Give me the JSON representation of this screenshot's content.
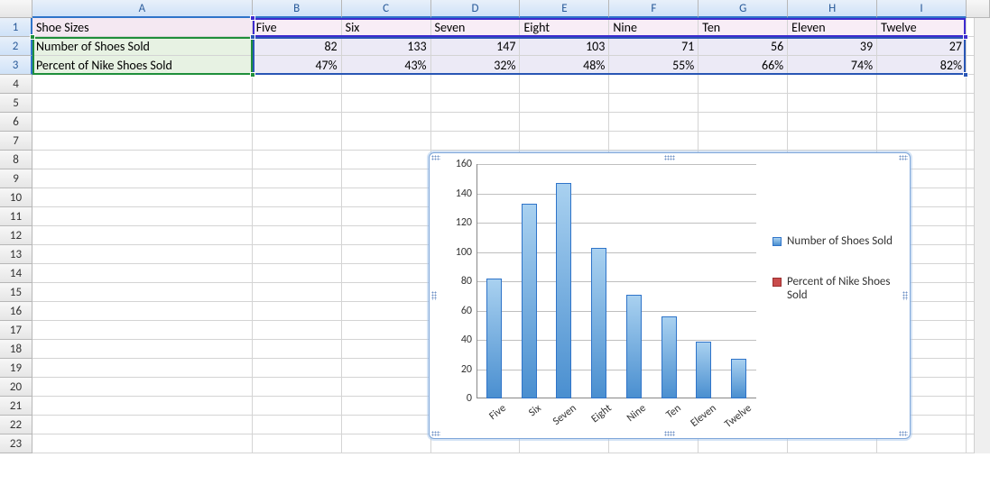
{
  "columns": [
    "A",
    "B",
    "C",
    "D",
    "E",
    "F",
    "G",
    "H",
    "I"
  ],
  "rowNumbers": [
    1,
    2,
    3,
    4,
    5,
    6,
    7,
    8,
    9,
    10,
    11,
    12,
    13,
    14,
    15,
    16,
    17,
    18,
    19,
    20,
    21,
    22,
    23
  ],
  "table": {
    "labels": {
      "sizes": "Shoe Sizes",
      "count": "Number of Shoes Sold",
      "pct": "Percent of Nike Shoes Sold"
    },
    "sizeNames": [
      "Five",
      "Six",
      "Seven",
      "Eight",
      "Nine",
      "Ten",
      "Eleven",
      "Twelve"
    ],
    "counts": [
      "82",
      "133",
      "147",
      "103",
      "71",
      "56",
      "39",
      "27"
    ],
    "percents": [
      "47%",
      "43%",
      "32%",
      "48%",
      "55%",
      "66%",
      "74%",
      "82%"
    ]
  },
  "chart_data": {
    "type": "bar",
    "categories": [
      "Five",
      "Six",
      "Seven",
      "Eight",
      "Nine",
      "Ten",
      "Eleven",
      "Twelve"
    ],
    "series": [
      {
        "name": "Number of Shoes Sold",
        "values": [
          82,
          133,
          147,
          103,
          71,
          56,
          39,
          27
        ]
      },
      {
        "name": "Percent of Nike Shoes Sold",
        "values": [
          0.47,
          0.43,
          0.32,
          0.48,
          0.55,
          0.66,
          0.74,
          0.82
        ]
      }
    ],
    "ylim": [
      0,
      160
    ],
    "ystep": 20,
    "xlabel": "",
    "ylabel": ""
  },
  "legend": {
    "items": [
      "Number of Shoes Sold",
      "Percent of Nike Shoes Sold"
    ]
  },
  "colors": {
    "barFill": "#4a8fd0",
    "series2": "#c94c4c",
    "selPurple": "#3d2bcf",
    "selGreen": "#1f8f3b",
    "selBlue": "#2956b5"
  }
}
